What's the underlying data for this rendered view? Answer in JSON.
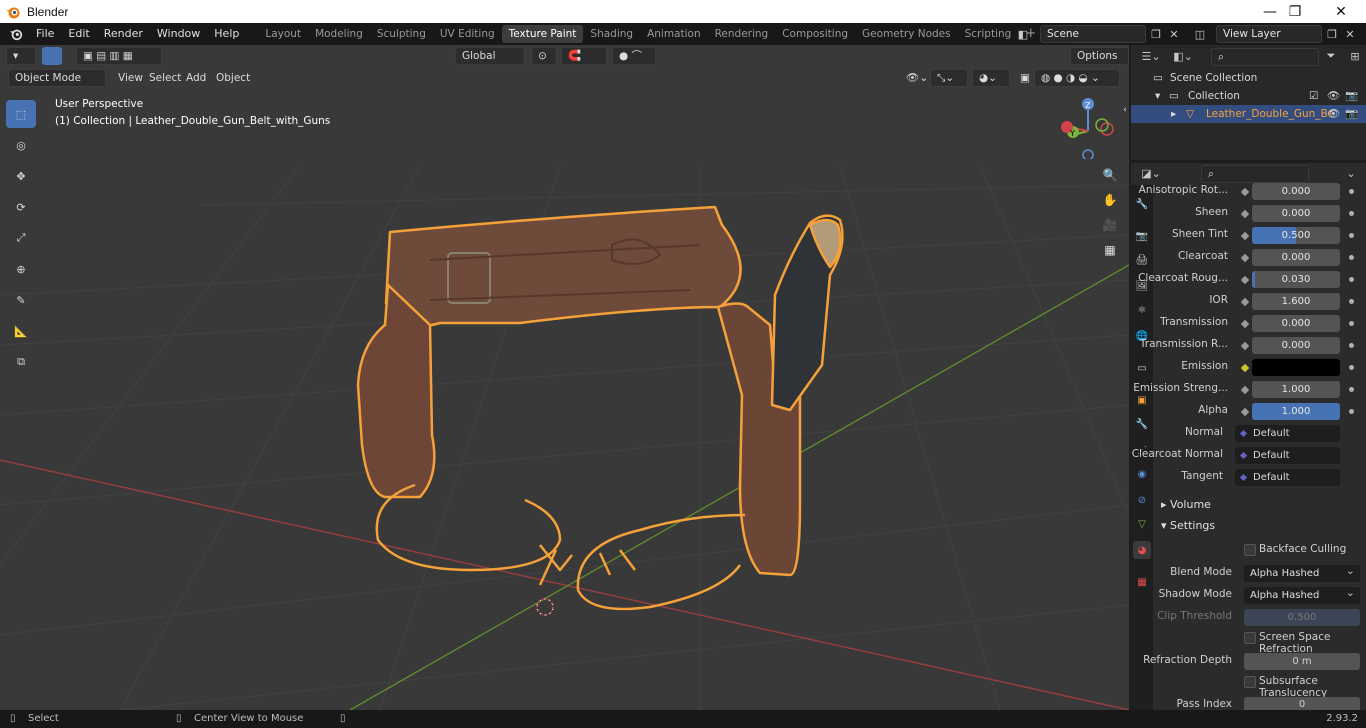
{
  "window": {
    "title": "Blender",
    "minimize": "—",
    "maximize": "❐",
    "close": "✕"
  },
  "menu": [
    "File",
    "Edit",
    "Render",
    "Window",
    "Help"
  ],
  "workspaces": [
    "Layout",
    "Modeling",
    "Sculpting",
    "UV Editing",
    "Texture Paint",
    "Shading",
    "Animation",
    "Rendering",
    "Compositing",
    "Geometry Nodes",
    "Scripting"
  ],
  "active_workspace": "Texture Paint",
  "scene": "Scene",
  "view_layer": "View Layer",
  "viewport": {
    "transform_orientation": "Global",
    "options_label": "Options",
    "mode": "Object Mode",
    "header_menus": [
      "View",
      "Select",
      "Add",
      "Object"
    ],
    "overlay_title": "User Perspective",
    "overlay_subtitle": "(1) Collection | Leather_Double_Gun_Belt_with_Guns",
    "gizmo": {
      "z": "Z",
      "y": "Y"
    }
  },
  "outliner": {
    "scene_collection": "Scene Collection",
    "collection": "Collection",
    "object": "Leather_Double_Gun_Be"
  },
  "properties": {
    "rows": [
      {
        "label": "Anisotropic Rot...",
        "value": "0.000",
        "fill": 0
      },
      {
        "label": "Sheen",
        "value": "0.000",
        "fill": 0
      },
      {
        "label": "Sheen Tint",
        "value": "0.500",
        "fill": 0.5
      },
      {
        "label": "Clearcoat",
        "value": "0.000",
        "fill": 0
      },
      {
        "label": "Clearcoat Roug...",
        "value": "0.030",
        "fill": 0.03
      },
      {
        "label": "IOR",
        "value": "1.600",
        "fill": 0
      },
      {
        "label": "Transmission",
        "value": "0.000",
        "fill": 0
      },
      {
        "label": "Transmission R...",
        "value": "0.000",
        "fill": 0
      },
      {
        "label": "Emission",
        "value": "",
        "color": "#000000"
      },
      {
        "label": "Emission Streng...",
        "value": "1.000",
        "fill": 0
      },
      {
        "label": "Alpha",
        "value": "1.000",
        "fill": 1
      }
    ],
    "links": [
      {
        "label": "Normal",
        "value": "Default"
      },
      {
        "label": "Clearcoat Normal",
        "value": "Default"
      },
      {
        "label": "Tangent",
        "value": "Default"
      }
    ],
    "panels": {
      "volume": "Volume",
      "settings": "Settings"
    },
    "settings": {
      "backface_culling": "Backface Culling",
      "blend_mode_label": "Blend Mode",
      "blend_mode": "Alpha Hashed",
      "shadow_mode_label": "Shadow Mode",
      "shadow_mode": "Alpha Hashed",
      "clip_threshold_label": "Clip Threshold",
      "clip_threshold": "0.500",
      "ssr": "Screen Space Refraction",
      "refraction_depth_label": "Refraction Depth",
      "refraction_depth": "0 m",
      "sss": "Subsurface Translucency",
      "pass_index_label": "Pass Index",
      "pass_index": "0"
    }
  },
  "status": {
    "left": "Select",
    "middle": "Center View to Mouse",
    "version": "2.93.2"
  },
  "colors": {
    "accent": "#4772b3",
    "outline": "#f5a13a",
    "leather": "#6e4a3a"
  }
}
